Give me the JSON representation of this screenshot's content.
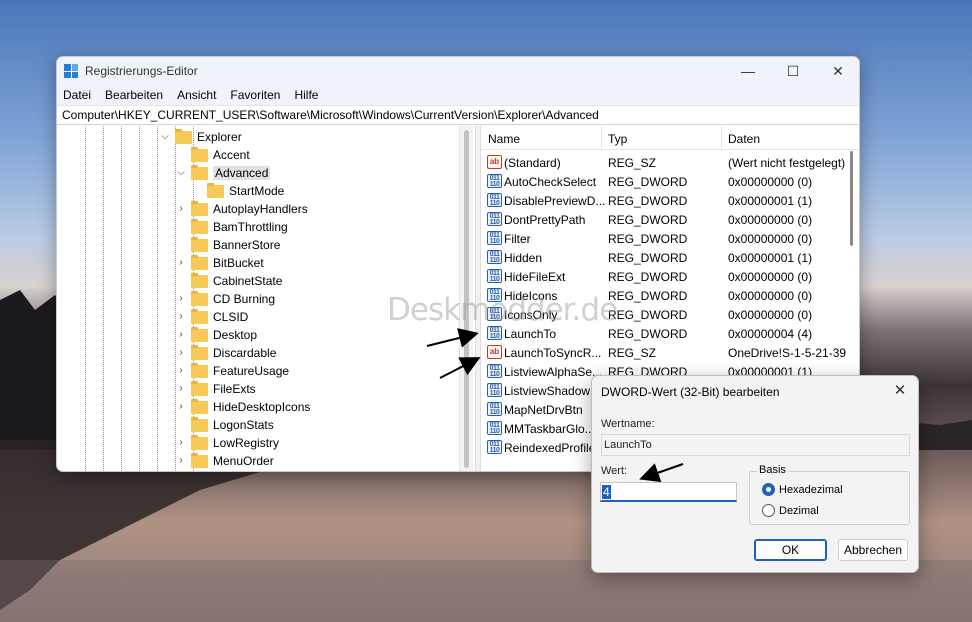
{
  "window": {
    "title": "Registrierungs-Editor",
    "minimize": "—",
    "maximize": "☐",
    "close": "✕"
  },
  "menu": [
    "Datei",
    "Bearbeiten",
    "Ansicht",
    "Favoriten",
    "Hilfe"
  ],
  "address": "Computer\\HKEY_CURRENT_USER\\Software\\Microsoft\\Windows\\CurrentVersion\\Explorer\\Advanced",
  "tree": {
    "items": [
      {
        "label": "Explorer",
        "chevron": "⌵",
        "level": 0
      },
      {
        "label": "Accent",
        "chevron": "",
        "level": 1
      },
      {
        "label": "Advanced",
        "chevron": "⌵",
        "level": 1,
        "selected": true
      },
      {
        "label": "StartMode",
        "chevron": "",
        "level": 2
      },
      {
        "label": "AutoplayHandlers",
        "chevron": "›",
        "level": 1
      },
      {
        "label": "BamThrottling",
        "chevron": "",
        "level": 1
      },
      {
        "label": "BannerStore",
        "chevron": "",
        "level": 1
      },
      {
        "label": "BitBucket",
        "chevron": "›",
        "level": 1
      },
      {
        "label": "CabinetState",
        "chevron": "",
        "level": 1
      },
      {
        "label": "CD Burning",
        "chevron": "›",
        "level": 1
      },
      {
        "label": "CLSID",
        "chevron": "›",
        "level": 1
      },
      {
        "label": "Desktop",
        "chevron": "›",
        "level": 1
      },
      {
        "label": "Discardable",
        "chevron": "›",
        "level": 1
      },
      {
        "label": "FeatureUsage",
        "chevron": "›",
        "level": 1
      },
      {
        "label": "FileExts",
        "chevron": "›",
        "level": 1
      },
      {
        "label": "HideDesktopIcons",
        "chevron": "›",
        "level": 1
      },
      {
        "label": "LogonStats",
        "chevron": "",
        "level": 1
      },
      {
        "label": "LowRegistry",
        "chevron": "›",
        "level": 1
      },
      {
        "label": "MenuOrder",
        "chevron": "›",
        "level": 1
      }
    ]
  },
  "list": {
    "columns": [
      "Name",
      "Typ",
      "Daten"
    ],
    "rows": [
      {
        "icon": "ab",
        "name": "(Standard)",
        "type": "REG_SZ",
        "data": "(Wert nicht festgelegt)"
      },
      {
        "icon": "bin",
        "name": "AutoCheckSelect",
        "type": "REG_DWORD",
        "data": "0x00000000 (0)"
      },
      {
        "icon": "bin",
        "name": "DisablePreviewD...",
        "type": "REG_DWORD",
        "data": "0x00000001 (1)"
      },
      {
        "icon": "bin",
        "name": "DontPrettyPath",
        "type": "REG_DWORD",
        "data": "0x00000000 (0)"
      },
      {
        "icon": "bin",
        "name": "Filter",
        "type": "REG_DWORD",
        "data": "0x00000000 (0)"
      },
      {
        "icon": "bin",
        "name": "Hidden",
        "type": "REG_DWORD",
        "data": "0x00000001 (1)"
      },
      {
        "icon": "bin",
        "name": "HideFileExt",
        "type": "REG_DWORD",
        "data": "0x00000000 (0)"
      },
      {
        "icon": "bin",
        "name": "HideIcons",
        "type": "REG_DWORD",
        "data": "0x00000000 (0)"
      },
      {
        "icon": "bin",
        "name": "IconsOnly",
        "type": "REG_DWORD",
        "data": "0x00000000 (0)"
      },
      {
        "icon": "bin",
        "name": "LaunchTo",
        "type": "REG_DWORD",
        "data": "0x00000004 (4)"
      },
      {
        "icon": "ab",
        "name": "LaunchToSyncR...",
        "type": "REG_SZ",
        "data": "OneDrive!S-1-5-21-39"
      },
      {
        "icon": "bin",
        "name": "ListviewAlphaSe...",
        "type": "REG_DWORD",
        "data": "0x00000001 (1)"
      },
      {
        "icon": "bin",
        "name": "ListviewShadow",
        "type": "",
        "data": ""
      },
      {
        "icon": "bin",
        "name": "MapNetDrvBtn",
        "type": "",
        "data": ""
      },
      {
        "icon": "bin",
        "name": "MMTaskbarGlo...",
        "type": "",
        "data": ""
      },
      {
        "icon": "bin",
        "name": "ReindexedProfile",
        "type": "",
        "data": ""
      }
    ]
  },
  "icons": {
    "string": "ab",
    "binary": "011\n110"
  },
  "watermark": "Deskmodder.de",
  "dialog": {
    "title": "DWORD-Wert (32-Bit) bearbeiten",
    "close": "✕",
    "name_label": "Wertname:",
    "name_value": "LaunchTo",
    "value_label": "Wert:",
    "value": "4",
    "base_label": "Basis",
    "radio_hex": "Hexadezimal",
    "radio_dec": "Dezimal",
    "ok": "OK",
    "cancel": "Abbrechen"
  }
}
